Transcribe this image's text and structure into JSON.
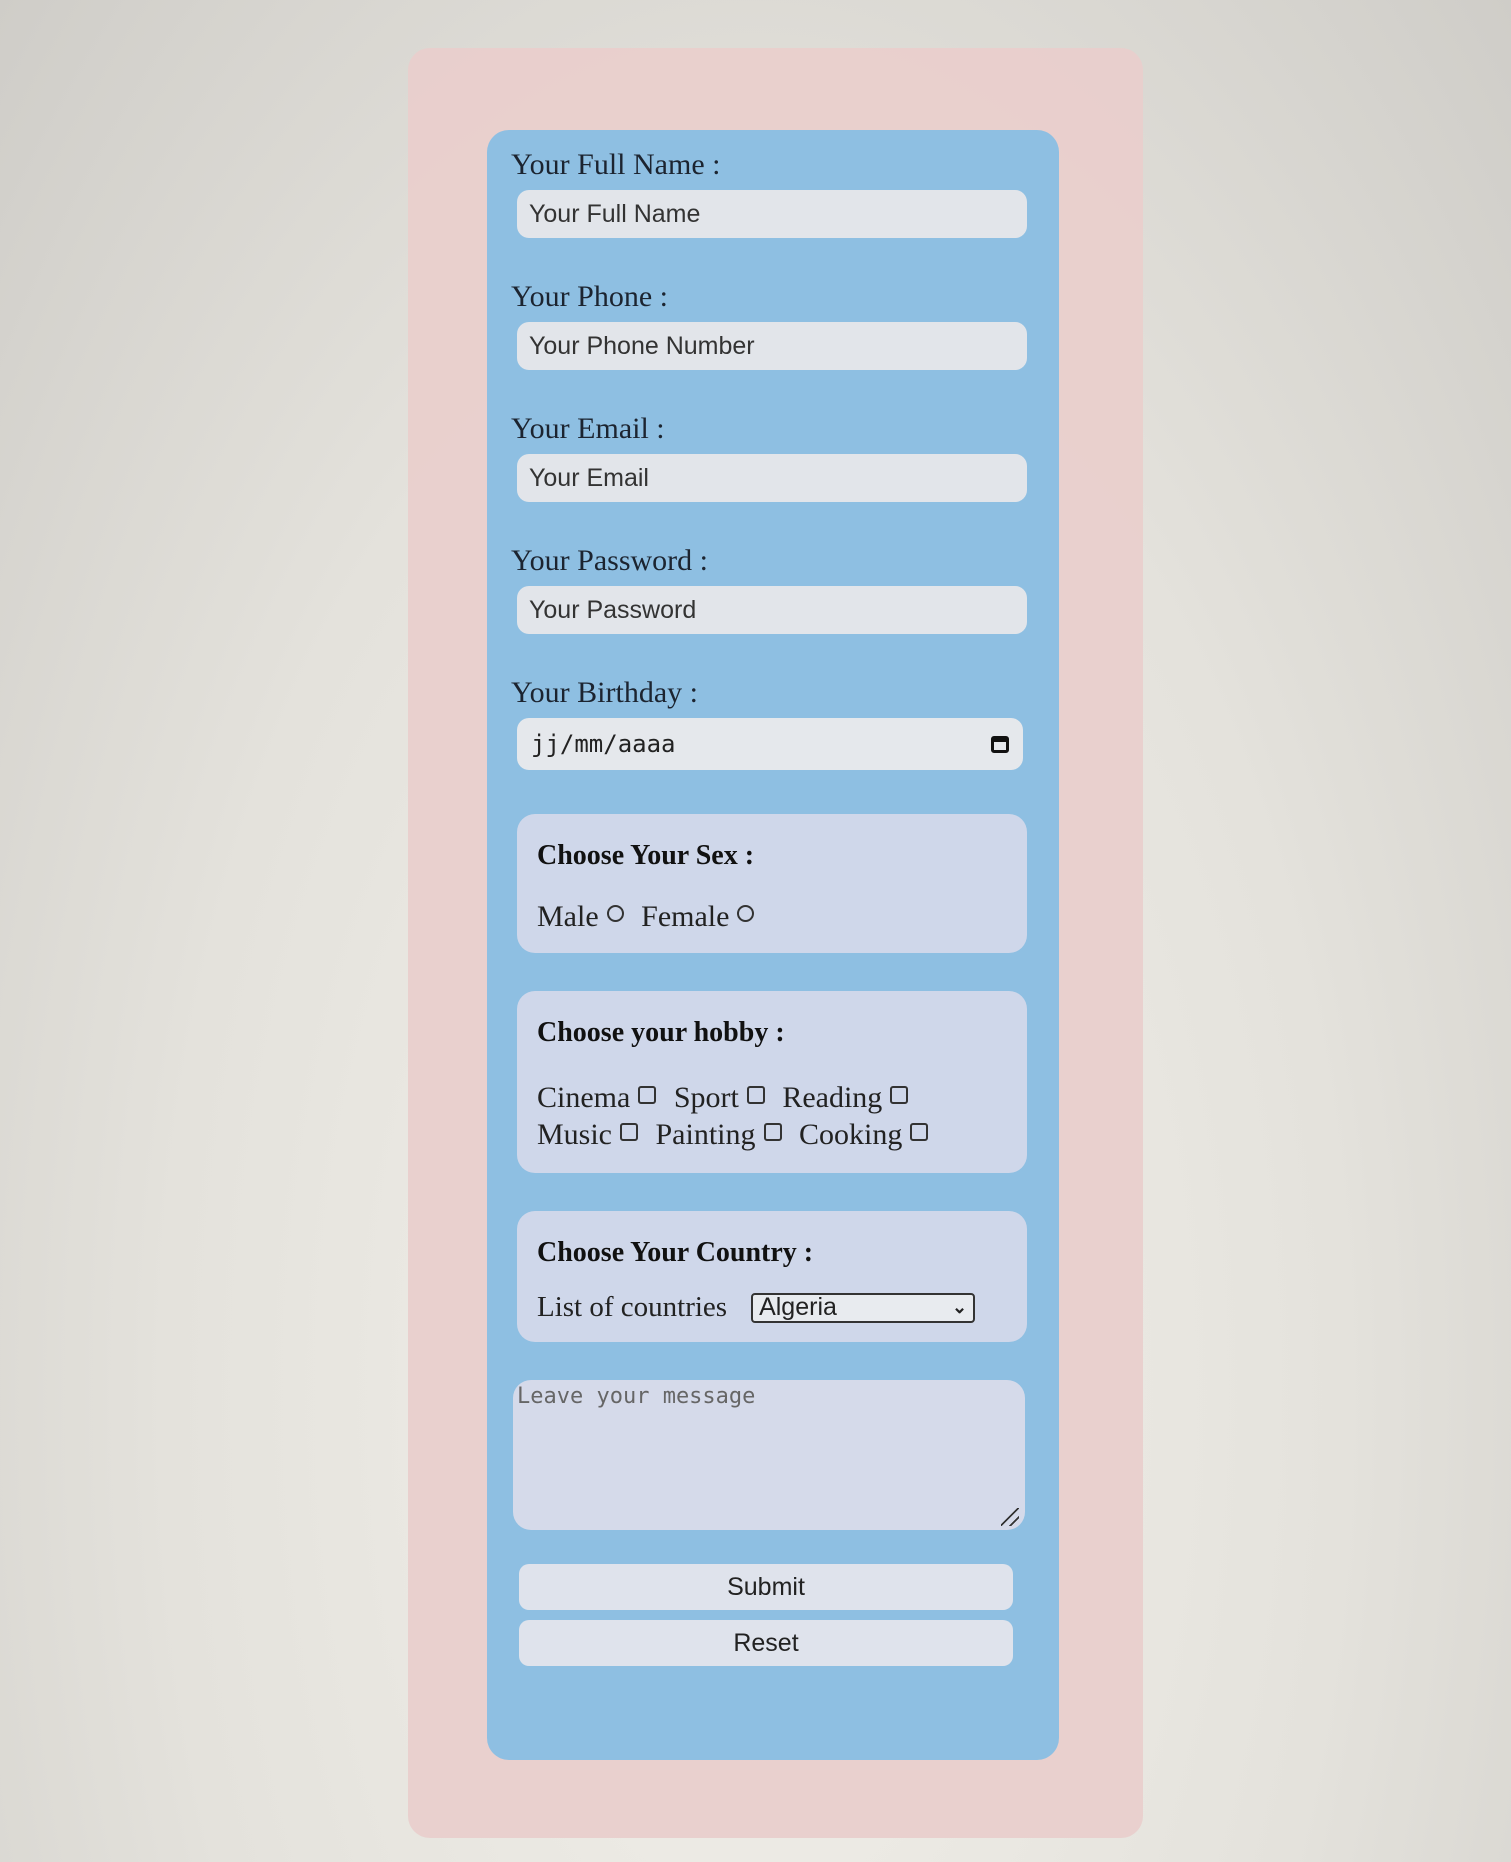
{
  "form": {
    "full_name": {
      "label": "Your Full Name :",
      "placeholder": "Your Full Name"
    },
    "phone": {
      "label": "Your Phone :",
      "placeholder": "Your Phone Number"
    },
    "email": {
      "label": "Your Email :",
      "placeholder": "Your Email"
    },
    "password": {
      "label": "Your Password :",
      "placeholder": "Your Password"
    },
    "birthday": {
      "label": "Your Birthday :",
      "placeholder": "jj/mm/aaaa"
    },
    "sex": {
      "title": "Choose Your Sex :",
      "options": [
        "Male",
        "Female"
      ]
    },
    "hobby": {
      "title": "Choose your hobby :",
      "options": [
        "Cinema",
        "Sport",
        "Reading",
        "Music",
        "Painting",
        "Cooking"
      ]
    },
    "country": {
      "title": "Choose Your Country :",
      "list_label": "List of countries",
      "selected": "Algeria"
    },
    "message": {
      "placeholder": "Leave your message"
    },
    "submit_label": "Submit",
    "reset_label": "Reset"
  }
}
